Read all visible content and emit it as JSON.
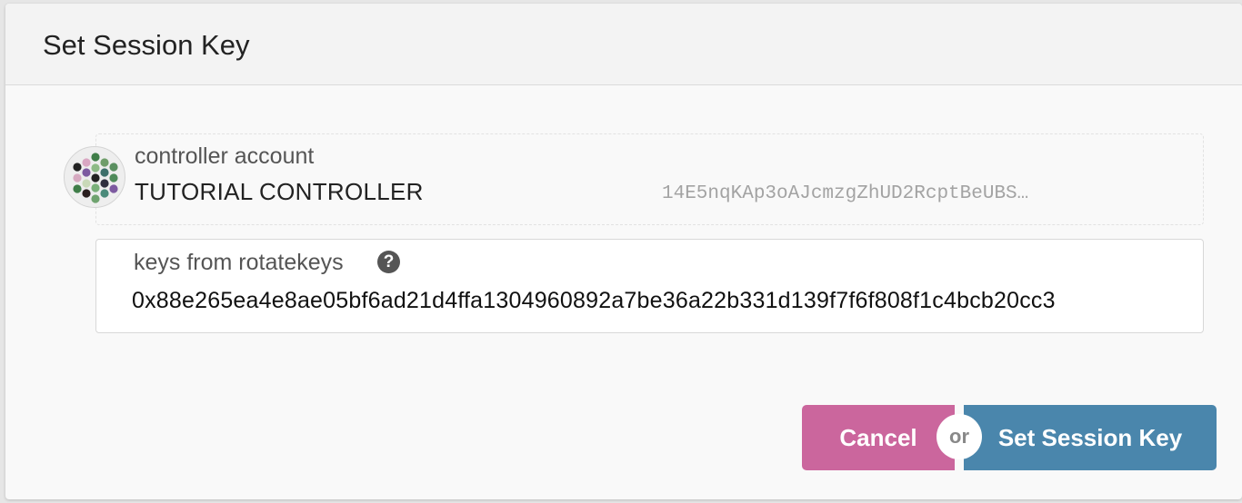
{
  "modal": {
    "title": "Set Session Key"
  },
  "controller": {
    "label": "controller account",
    "name": "TUTORIAL CONTROLLER",
    "address": "14E5nqKAp3oAJcmzgZhUD2RcptBeUBS…",
    "icon": "identicon"
  },
  "keys": {
    "label": "keys from rotatekeys",
    "help_icon": "?",
    "value": "0x88e265ea4e8ae05bf6ad21d4ffa1304960892a7be36a22b331d139f7f6f808f1c4bcb20cc3"
  },
  "actions": {
    "cancel_label": "Cancel",
    "or_label": "or",
    "submit_label": "Set Session Key"
  },
  "colors": {
    "cancel": "#cb669d",
    "submit": "#4a86ac"
  }
}
